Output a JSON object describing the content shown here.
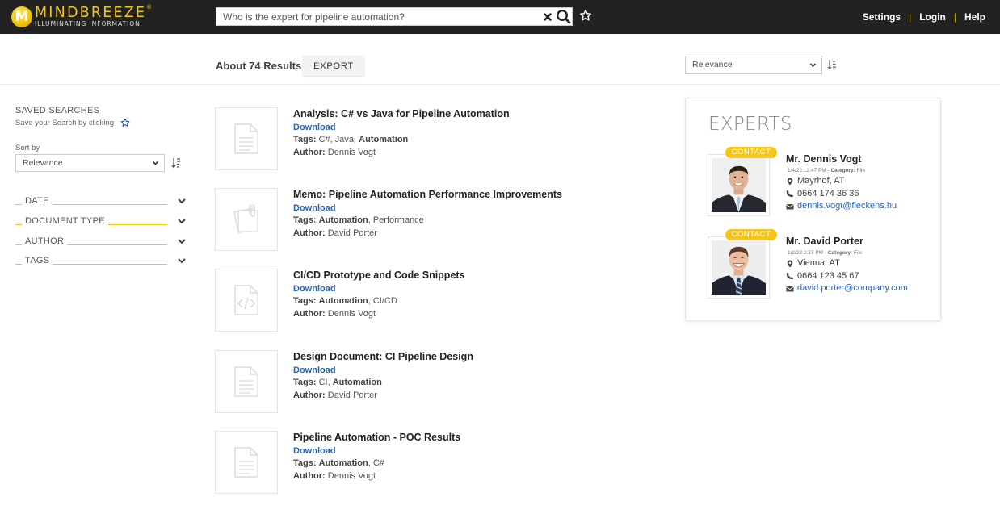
{
  "header": {
    "logo": {
      "mark": "M",
      "name": "MINDBREEZE",
      "registered": "®",
      "tagline": "ILLUMINATING INFORMATION"
    },
    "search": {
      "value": "Who is the expert for pipeline automation?",
      "placeholder": ""
    },
    "icons": {
      "clear": "close-icon",
      "search": "search-icon",
      "save": "star-outline-icon"
    },
    "nav": [
      {
        "label": "Settings"
      },
      {
        "label": "Login"
      },
      {
        "label": "Help"
      }
    ],
    "nav_separator": "|"
  },
  "toolbar": {
    "results_count": "About 74 Results",
    "export_label": "EXPORT",
    "sort_selected": "Relevance"
  },
  "sidebar": {
    "saved_searches_title": "SAVED SEARCHES",
    "saved_searches_hint": "Save your Search by clicking",
    "sort_by_label": "Sort by",
    "sort_selected": "Relevance",
    "facets": [
      {
        "label": "DATE"
      },
      {
        "label": "DOCUMENT TYPE"
      },
      {
        "label": "AUTHOR"
      },
      {
        "label": "TAGS"
      }
    ]
  },
  "results": [
    {
      "title": "Analysis: C# vs Java for Pipeline Automation",
      "download_label": "Download",
      "icon": "document-icon",
      "tags_label": "Tags:",
      "tags": [
        {
          "text": "C#",
          "bold": false
        },
        {
          "text": "Java",
          "bold": false
        },
        {
          "text": "Automation",
          "bold": true
        }
      ],
      "author_label": "Author:",
      "author": "Dennis Vogt"
    },
    {
      "title": "Memo: Pipeline Automation Performance Improvements",
      "download_label": "Download",
      "icon": "memo-icon",
      "tags_label": "Tags:",
      "tags": [
        {
          "text": "Automation",
          "bold": true
        },
        {
          "text": "Performance",
          "bold": false
        }
      ],
      "author_label": "Author:",
      "author": "David Porter"
    },
    {
      "title": "CI/CD Prototype and Code Snippets",
      "download_label": "Download",
      "icon": "code-file-icon",
      "tags_label": "Tags:",
      "tags": [
        {
          "text": "Automation",
          "bold": true
        },
        {
          "text": "CI/CD",
          "bold": false
        }
      ],
      "author_label": "Author:",
      "author": "Dennis Vogt"
    },
    {
      "title": "Design Document: CI Pipeline Design",
      "download_label": "Download",
      "icon": "document-icon",
      "tags_label": "Tags:",
      "tags": [
        {
          "text": "CI",
          "bold": false
        },
        {
          "text": "Automation",
          "bold": true
        }
      ],
      "author_label": "Author:",
      "author": "David Porter"
    },
    {
      "title": "Pipeline Automation - POC Results",
      "download_label": "Download",
      "icon": "document-icon",
      "tags_label": "Tags:",
      "tags": [
        {
          "text": "Automation",
          "bold": true
        },
        {
          "text": "C#",
          "bold": false
        }
      ],
      "author_label": "Author:",
      "author": "Dennis Vogt"
    }
  ],
  "experts": {
    "title": "EXPERTS",
    "contact_label": "CONTACT",
    "people": [
      {
        "name": "Mr. Dennis Vogt",
        "date": "1/4/22 12:47 PM",
        "category_label": "Category:",
        "category": "File",
        "location": "Mayrhof, AT",
        "phone": "0664 174 36 36",
        "email": "dennis.vogt@fleckens.hu"
      },
      {
        "name": "Mr. David Porter",
        "date": "1/2/22 2:37 PM",
        "category_label": "Category:",
        "category": "File",
        "location": "Vienna, AT",
        "phone": "0664 123 45 67",
        "email": "david.porter@company.com"
      }
    ]
  },
  "colors": {
    "topbar_bg": "#222222",
    "brand_yellow": "#f3c61a",
    "link_blue": "#2a64b0",
    "contact_badge": "#f6c515"
  }
}
